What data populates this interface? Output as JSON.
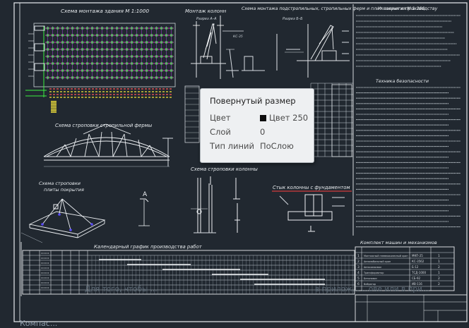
{
  "drawing": {
    "titles": {
      "erection_plan": "Схема монтажа здания М 1:1000",
      "column_install": "Монтаж колонн",
      "section_aa": "Разрез А–А",
      "truss_slab_install": "Схема монтажа подстропильных, стропильных ферм и плит покрытия  М 1:200",
      "section_bb": "Разрез Б–Б",
      "work_notes": "Указания к производству",
      "safety": "Техника безопасности",
      "truss_slinging": "Схема строповки стропильной фермы",
      "column_slinging": "Схема строповки колонны",
      "slab_slinging_1": "Схема строповки",
      "slab_slinging_2": "плиты покрытия",
      "column_foundation": "Стык колонны с фундаментом",
      "schedule": "Календарный график производства работ",
      "machines": "Комплект машин и механизмов",
      "crane_label": "КС-35",
      "section_a_mark": "А"
    },
    "machines_rows": [
      {
        "n": "1",
        "name": "Монтажный пневмоколесный кран",
        "mark": "МКП-25",
        "qty": "1"
      },
      {
        "n": "2",
        "name": "Автомобильный кран",
        "mark": "КС-3562",
        "qty": "1"
      },
      {
        "n": "3",
        "name": "Автосамосвал",
        "mark": "Б-12",
        "qty": "2"
      },
      {
        "n": "4",
        "name": "Трансформатор",
        "mark": "ТСД-1000",
        "qty": "1"
      },
      {
        "n": "5",
        "name": "Бетоновоз",
        "mark": "СБ-92",
        "qty": "2"
      },
      {
        "n": "6",
        "name": "Вибратор",
        "mark": "ИВ-116",
        "qty": "2"
      }
    ]
  },
  "tooltip": {
    "title": "Повернутый размер",
    "color_label": "Цвет",
    "color_value": "Цвет 250",
    "color_swatch": "#0d0d0d",
    "layer_label": "Слой",
    "layer_value": "0",
    "linetype_label": "Тип линий",
    "linetype_value": "ПоСлою"
  },
  "underlay": {
    "ghost_left": "Для того, чтобы ...",
    "ghost_right": "в прилож...                   ...ове  или в при...",
    "bottom_label": "Компас..."
  }
}
